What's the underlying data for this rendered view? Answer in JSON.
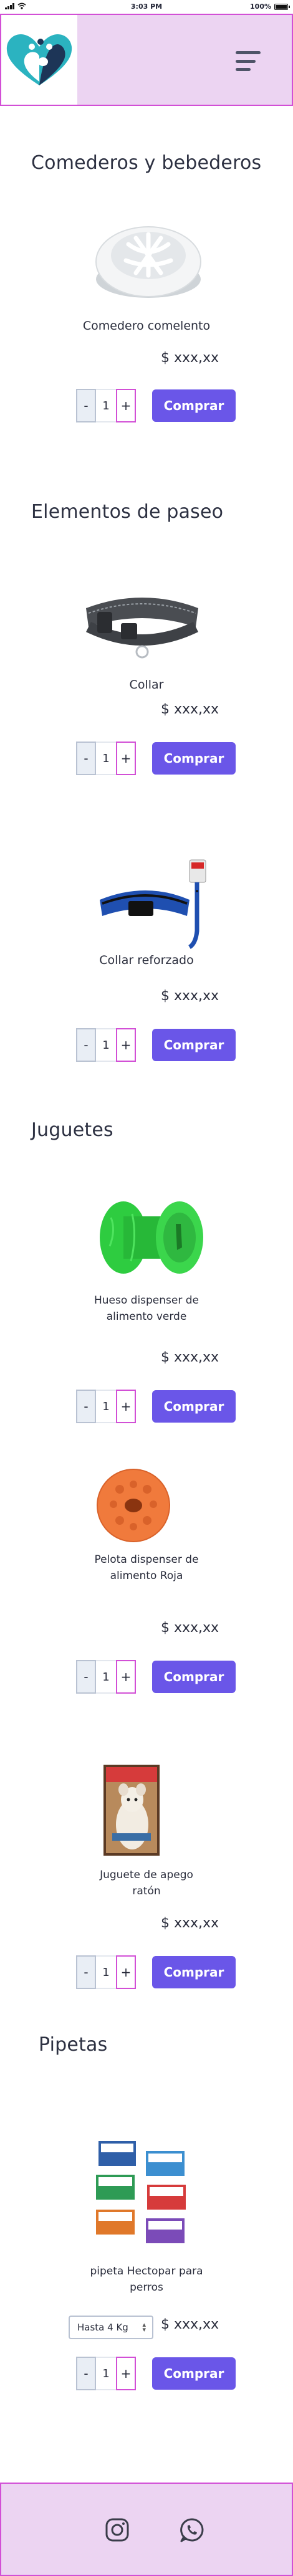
{
  "status_bar": {
    "time": "3:03 PM",
    "battery": "100%",
    "battery_level": 1.0
  },
  "header": {
    "logo": "paw-heart-logo",
    "menu_icon": "hamburger-menu-icon"
  },
  "sections": [
    {
      "title": "Comederos y bebederos",
      "products": [
        {
          "name": "Comedero comelento",
          "price": "$ xxx,xx",
          "quantity": "1",
          "minus": "-",
          "plus": "+",
          "buy_label": "Comprar"
        }
      ]
    },
    {
      "title": "Elementos de paseo",
      "products": [
        {
          "name": "Collar",
          "price": "$ xxx,xx",
          "quantity": "1",
          "minus": "-",
          "plus": "+",
          "buy_label": "Comprar"
        },
        {
          "name": "Collar reforzado",
          "price": "$ xxx,xx",
          "quantity": "1",
          "minus": "-",
          "plus": "+",
          "buy_label": "Comprar"
        }
      ]
    },
    {
      "title": "Juguetes",
      "products": [
        {
          "name_line1": "Hueso dispenser de",
          "name_line2": "alimento verde",
          "price": "$ xxx,xx",
          "quantity": "1",
          "minus": "-",
          "plus": "+",
          "buy_label": "Comprar"
        },
        {
          "name_line1": "Pelota dispenser de",
          "name_line2": "alimento Roja",
          "price": "$ xxx,xx",
          "quantity": "1",
          "minus": "-",
          "plus": "+",
          "buy_label": "Comprar"
        },
        {
          "name_line1": "Juguete de apego",
          "name_line2": "ratón",
          "price": "$ xxx,xx",
          "quantity": "1",
          "minus": "-",
          "plus": "+",
          "buy_label": "Comprar"
        }
      ]
    },
    {
      "title": "Pipetas",
      "products": [
        {
          "name_line1": "pipeta Hectopar para",
          "name_line2": "perros",
          "price": "$ xxx,xx",
          "size_selected": "Hasta 4 Kg",
          "quantity": "1",
          "minus": "-",
          "plus": "+",
          "buy_label": "Comprar"
        }
      ]
    }
  ],
  "footer": {
    "icons": [
      "instagram-icon",
      "whatsapp-icon"
    ]
  },
  "colors": {
    "accent": "#6a56e8",
    "header_bg": "#ecd4f2",
    "border_pink": "#d24fd6",
    "logo_teal": "#2bb3c0",
    "logo_navy": "#1d3557"
  }
}
